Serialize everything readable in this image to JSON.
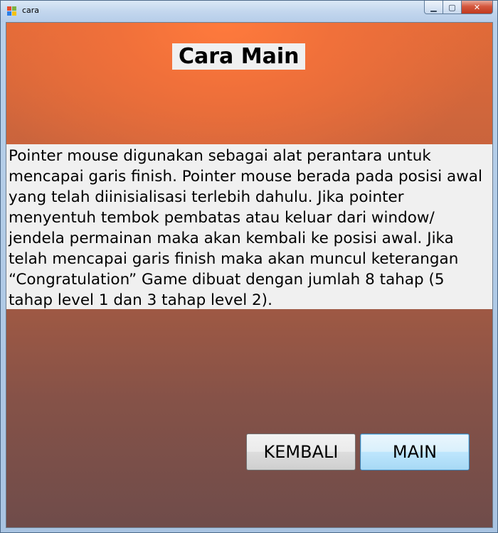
{
  "window": {
    "title": "cara",
    "minimize_glyph": "▁",
    "maximize_glyph": "▢",
    "close_glyph": "✕"
  },
  "content": {
    "heading": "Cara Main",
    "description": "Pointer mouse digunakan sebagai alat perantara untuk mencapai garis finish. Pointer mouse berada pada posisi awal yang telah diinisialisasi terlebih dahulu. Jika pointer menyentuh tembok pembatas atau keluar dari window/ jendela permainan maka akan kembali ke posisi awal. Jika telah mencapai garis finish maka akan muncul keterangan “Congratulation” Game dibuat dengan jumlah 8 tahap (5 tahap level 1 dan 3 tahap level 2).",
    "back_label": "KEMBALI",
    "play_label": "MAIN"
  },
  "colors": {
    "background_top": "#e06a38",
    "background_bottom": "#6f4c4a",
    "panel": "#f0f0f0",
    "close_button": "#c0391f"
  },
  "icons": {
    "app": "windows-form-icon",
    "minimize": "minimize-icon",
    "maximize": "maximize-icon",
    "close": "close-icon"
  }
}
